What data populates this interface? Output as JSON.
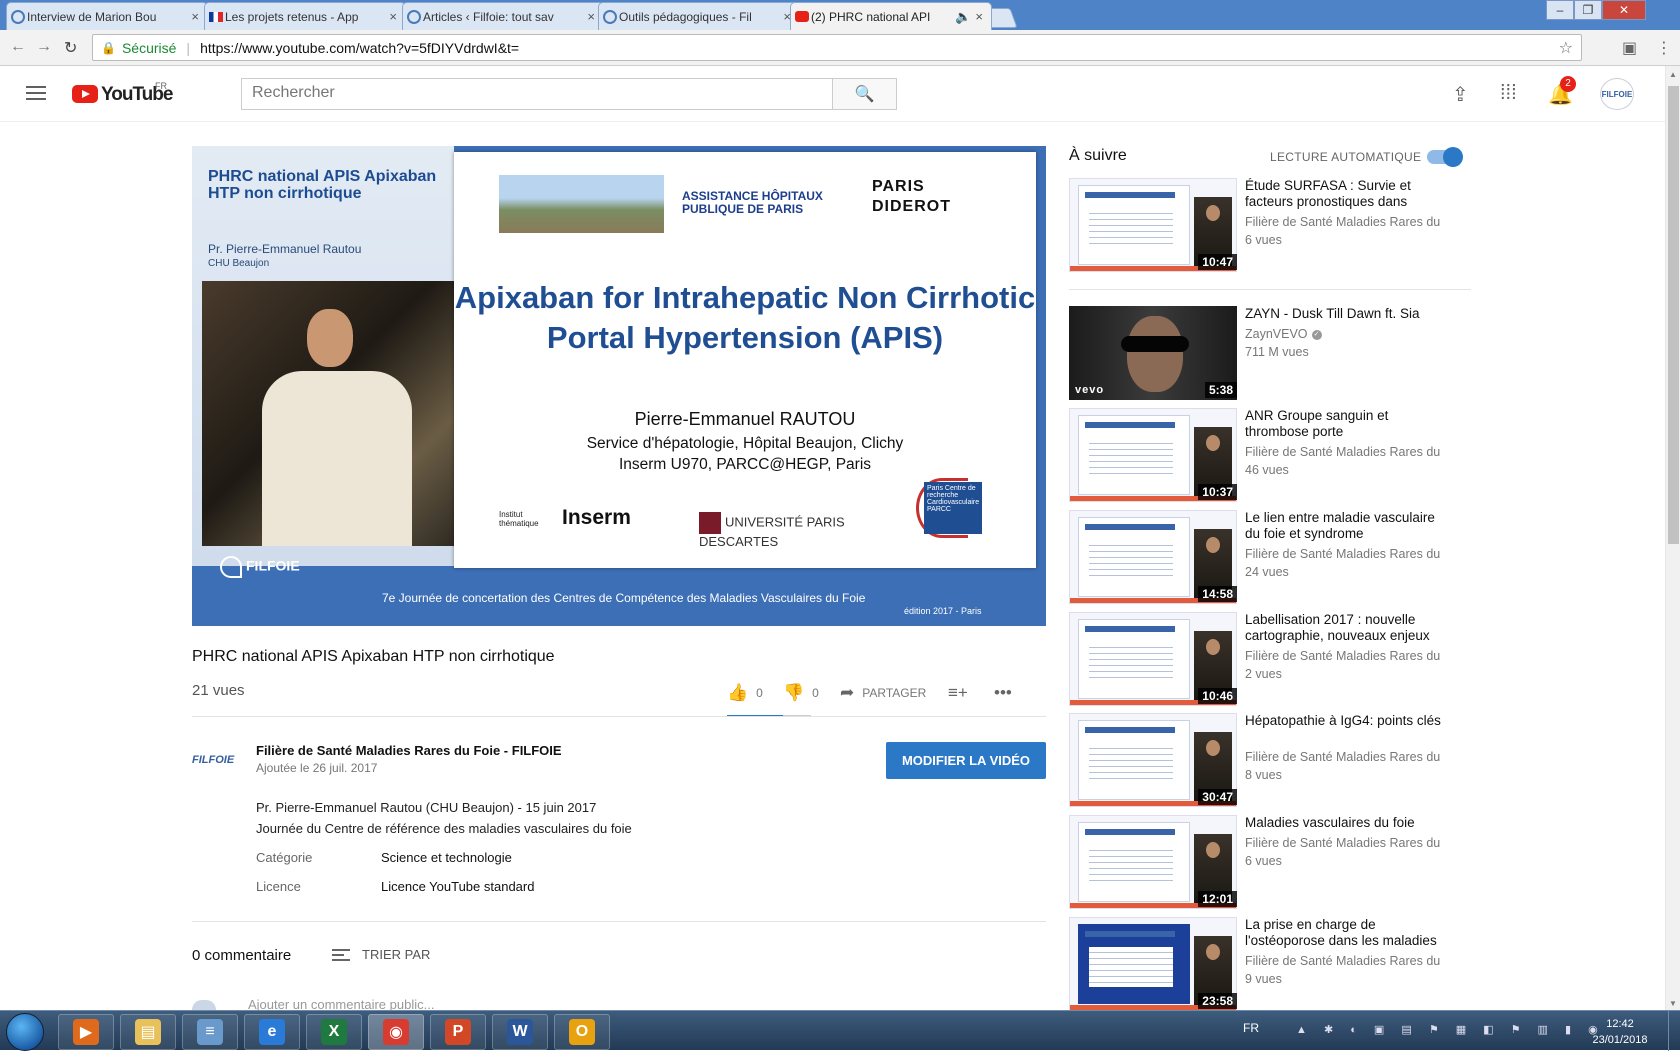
{
  "browser": {
    "tabs": [
      {
        "label": "Interview de Marion Bou",
        "favicon": "filfoie-icon"
      },
      {
        "label": "Les projets retenus - App",
        "favicon": "french-flag-icon"
      },
      {
        "label": "Articles ‹ Filfoie: tout sav",
        "favicon": "filfoie-icon"
      },
      {
        "label": "Outils pédagogiques - Fil",
        "favicon": "filfoie-icon"
      },
      {
        "label": "(2) PHRC national API",
        "favicon": "youtube-icon",
        "active": true
      }
    ],
    "secure_label": "Sécurisé",
    "url": "https://www.youtube.com/watch?v=5fDIYVdrdwI&t="
  },
  "header": {
    "logo_text": "YouTube",
    "country": "FR",
    "search_placeholder": "Rechercher",
    "notif_count": "2",
    "avatar_text": "FILFOIE"
  },
  "player": {
    "overlay_title": "PHRC national APIS Apixaban HTP non cirrhotique",
    "presenter": "Pr. Pierre-Emmanuel Rautou",
    "presenter_org": "CHU Beaujon",
    "slide": {
      "aphp_line1": "ASSISTANCE HÔPITAUX",
      "aphp_line2": "PUBLIQUE DE PARIS",
      "pd_line1": "PARIS",
      "pd_line2": "DIDEROT",
      "title": "Apixaban for Intrahepatic Non Cirrhotic Portal Hypertension (APIS)",
      "author": "Pierre-Emmanuel RAUTOU",
      "affil1": "Service d'hépatologie, Hôpital Beaujon, Clichy",
      "affil2": "Inserm U970, PARCC@HEGP, Paris",
      "inserm": "Inserm",
      "institut": "Institut thématique",
      "univ": "UNIVERSITÉ PARIS DESCARTES",
      "parcc": "Paris Centre de recherche Cardiovasculaire PARCC"
    },
    "brand": "FILFOIE",
    "footer": "7e Journée de concertation des Centres de Compétence des Maladies Vasculaires du Foie",
    "footer_edition": "édition 2017 - Paris"
  },
  "video": {
    "title": "PHRC national APIS Apixaban HTP non cirrhotique",
    "views": "21 vues",
    "likes": "0",
    "dislikes": "0",
    "share_label": "PARTAGER"
  },
  "channel": {
    "avatar_text": "FILFOIE",
    "name": "Filière de Santé Maladies Rares du Foie - FILFOIE",
    "added": "Ajoutée le 26 juil. 2017",
    "edit_button": "MODIFIER LA VIDÉO"
  },
  "description": {
    "line1": "Pr. Pierre-Emmanuel Rautou (CHU Beaujon) - 15 juin 2017",
    "line2": "Journée du Centre de référence des maladies vasculaires du foie",
    "category_label": "Catégorie",
    "category_value": "Science et technologie",
    "license_label": "Licence",
    "license_value": "Licence YouTube standard"
  },
  "comments": {
    "count": "0 commentaire",
    "sort_label": "TRIER PAR",
    "placeholder": "Ajouter un commentaire public..."
  },
  "sidebar": {
    "up_next": "À suivre",
    "autoplay_label": "LECTURE AUTOMATIQUE",
    "autoplay_on": true,
    "items": [
      {
        "title": "Étude SURFASA : Survie et facteurs pronostiques dans",
        "channel": "Filière de Santé Maladies Rares du",
        "views": "6 vues",
        "duration": "10:47",
        "thumb": "slide"
      },
      {
        "title": "ZAYN - Dusk Till Dawn ft. Sia",
        "channel": "ZaynVEVO",
        "verified": true,
        "views": "711 M vues",
        "duration": "5:38",
        "thumb": "music"
      },
      {
        "title": "ANR Groupe sanguin et thrombose porte",
        "channel": "Filière de Santé Maladies Rares du",
        "views": "46 vues",
        "duration": "10:37",
        "thumb": "slide"
      },
      {
        "title": "Le lien entre maladie vasculaire du foie et syndrome",
        "channel": "Filière de Santé Maladies Rares du",
        "views": "24 vues",
        "duration": "14:58",
        "thumb": "slide"
      },
      {
        "title": "Labellisation 2017 : nouvelle cartographie, nouveaux enjeux",
        "channel": "Filière de Santé Maladies Rares du",
        "views": "2 vues",
        "duration": "10:46",
        "thumb": "slide"
      },
      {
        "title": "Hépatopathie à IgG4: points clés",
        "channel": "Filière de Santé Maladies Rares du",
        "views": "8 vues",
        "duration": "30:47",
        "thumb": "slide"
      },
      {
        "title": "Maladies vasculaires du foie",
        "channel": "Filière de Santé Maladies Rares du",
        "views": "6 vues",
        "duration": "12:01",
        "thumb": "slide"
      },
      {
        "title": "La prise en charge de l'ostéoporose dans les maladies",
        "channel": "Filière de Santé Maladies Rares du",
        "views": "9 vues",
        "duration": "23:58",
        "thumb": "blue"
      }
    ]
  },
  "taskbar": {
    "lang": "FR",
    "time": "12:42",
    "date": "23/01/2018",
    "apps": [
      {
        "name": "media-player-icon",
        "glyph": "▶",
        "color": "#e06a1b"
      },
      {
        "name": "file-explorer-icon",
        "glyph": "▤",
        "color": "#e8c15a"
      },
      {
        "name": "notepad-icon",
        "glyph": "≡",
        "color": "#6a9acb"
      },
      {
        "name": "internet-explorer-icon",
        "glyph": "e",
        "color": "#2a7bd8"
      },
      {
        "name": "excel-icon",
        "glyph": "X",
        "color": "#1f7a3f"
      },
      {
        "name": "chrome-icon",
        "glyph": "◉",
        "color": "#d83b2f",
        "active": true
      },
      {
        "name": "powerpoint-icon",
        "glyph": "P",
        "color": "#d24726"
      },
      {
        "name": "word-icon",
        "glyph": "W",
        "color": "#2b579a"
      },
      {
        "name": "outlook-icon",
        "glyph": "O",
        "color": "#e8a10f"
      }
    ]
  }
}
